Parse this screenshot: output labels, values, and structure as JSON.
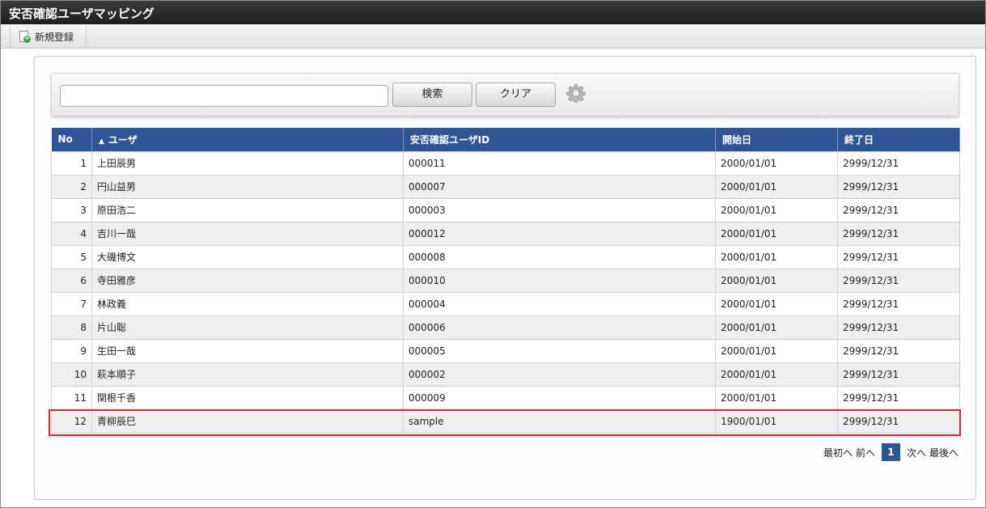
{
  "window": {
    "title": "安否確認ユーザマッピング"
  },
  "toolbar": {
    "new_label": "新規登録",
    "new_icon": "new-document-icon"
  },
  "search": {
    "input_value": "",
    "search_label": "検索",
    "clear_label": "クリア",
    "settings_icon": "gear-icon"
  },
  "table": {
    "header_color": "#2f5597",
    "columns": {
      "no": "No",
      "user": "ユーザ",
      "user_sort": "ascending",
      "anpi_id": "安否確認ユーザID",
      "start": "開始日",
      "end": "終了日"
    },
    "rows": [
      {
        "no": "1",
        "user": "上田辰男",
        "anpi_id": "000011",
        "start": "2000/01/01",
        "end": "2999/12/31"
      },
      {
        "no": "2",
        "user": "円山益男",
        "anpi_id": "000007",
        "start": "2000/01/01",
        "end": "2999/12/31"
      },
      {
        "no": "3",
        "user": "原田浩二",
        "anpi_id": "000003",
        "start": "2000/01/01",
        "end": "2999/12/31"
      },
      {
        "no": "4",
        "user": "吉川一哉",
        "anpi_id": "000012",
        "start": "2000/01/01",
        "end": "2999/12/31"
      },
      {
        "no": "5",
        "user": "大磯博文",
        "anpi_id": "000008",
        "start": "2000/01/01",
        "end": "2999/12/31"
      },
      {
        "no": "6",
        "user": "寺田雅彦",
        "anpi_id": "000010",
        "start": "2000/01/01",
        "end": "2999/12/31"
      },
      {
        "no": "7",
        "user": "林政義",
        "anpi_id": "000004",
        "start": "2000/01/01",
        "end": "2999/12/31"
      },
      {
        "no": "8",
        "user": "片山聡",
        "anpi_id": "000006",
        "start": "2000/01/01",
        "end": "2999/12/31"
      },
      {
        "no": "9",
        "user": "生田一哉",
        "anpi_id": "000005",
        "start": "2000/01/01",
        "end": "2999/12/31"
      },
      {
        "no": "10",
        "user": "萩本順子",
        "anpi_id": "000002",
        "start": "2000/01/01",
        "end": "2999/12/31"
      },
      {
        "no": "11",
        "user": "関根千香",
        "anpi_id": "000009",
        "start": "2000/01/01",
        "end": "2999/12/31"
      },
      {
        "no": "12",
        "user": "青柳辰巳",
        "anpi_id": "sample",
        "start": "1900/01/01",
        "end": "2999/12/31"
      }
    ],
    "highlight_color": "#e0242b"
  },
  "pager": {
    "first": "最初へ",
    "prev": "前へ",
    "current": "1",
    "next": "次へ",
    "last": "最後へ"
  }
}
